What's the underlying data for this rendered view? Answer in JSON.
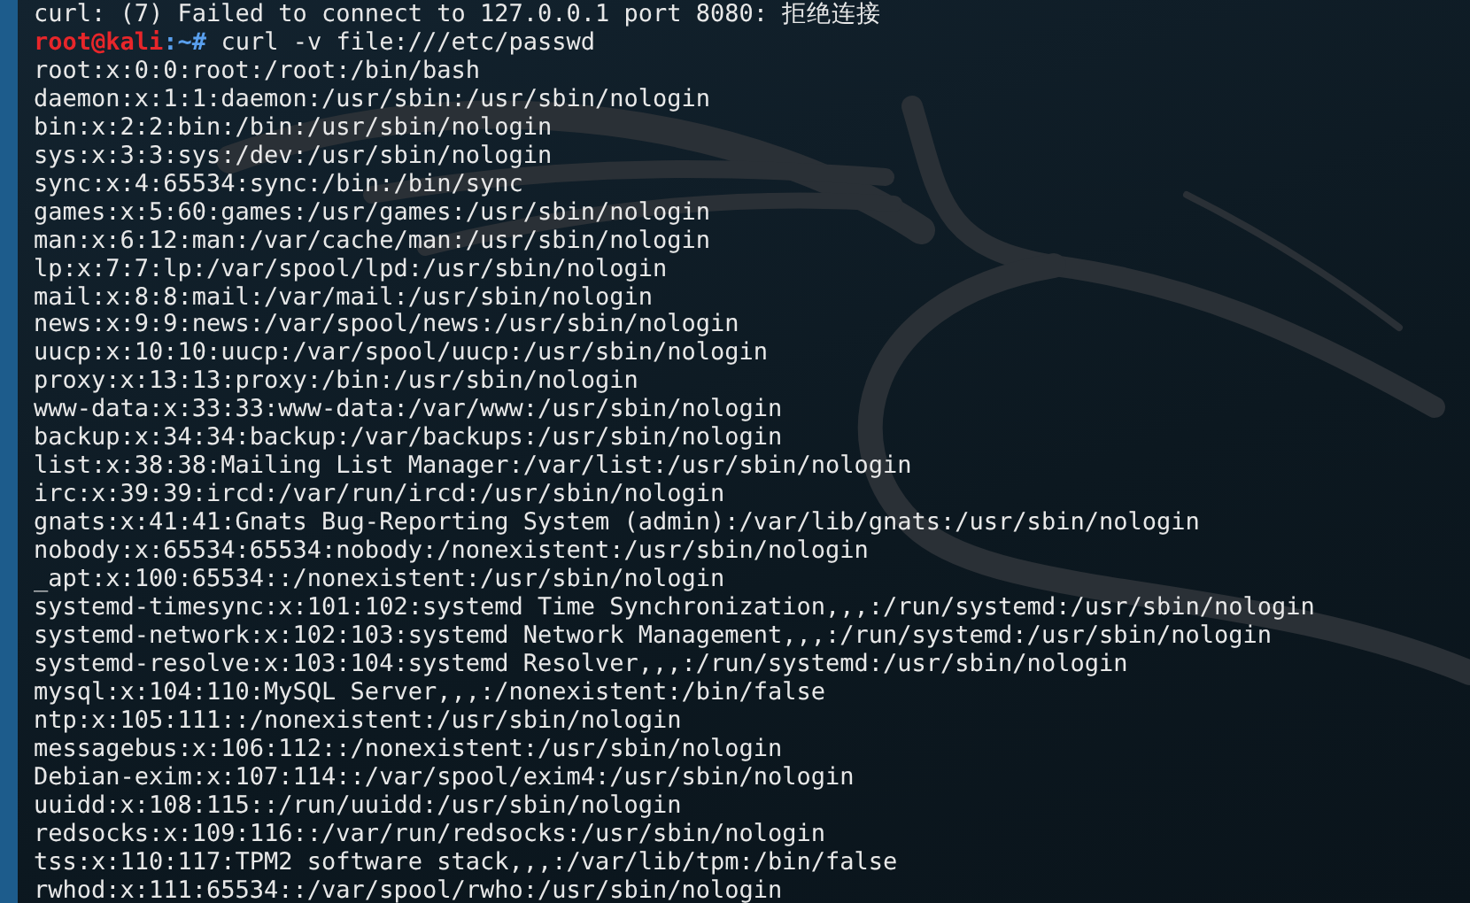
{
  "terminal": {
    "lines_before": [
      "curl: (7) Failed to connect to 127.0.0.1 port 8080: 拒绝连接"
    ],
    "prompt": {
      "user_host": "root@kali",
      "path": ":~#",
      "command": "curl -v file:///etc/passwd"
    },
    "output": [
      "root:x:0:0:root:/root:/bin/bash",
      "daemon:x:1:1:daemon:/usr/sbin:/usr/sbin/nologin",
      "bin:x:2:2:bin:/bin:/usr/sbin/nologin",
      "sys:x:3:3:sys:/dev:/usr/sbin/nologin",
      "sync:x:4:65534:sync:/bin:/bin/sync",
      "games:x:5:60:games:/usr/games:/usr/sbin/nologin",
      "man:x:6:12:man:/var/cache/man:/usr/sbin/nologin",
      "lp:x:7:7:lp:/var/spool/lpd:/usr/sbin/nologin",
      "mail:x:8:8:mail:/var/mail:/usr/sbin/nologin",
      "news:x:9:9:news:/var/spool/news:/usr/sbin/nologin",
      "uucp:x:10:10:uucp:/var/spool/uucp:/usr/sbin/nologin",
      "proxy:x:13:13:proxy:/bin:/usr/sbin/nologin",
      "www-data:x:33:33:www-data:/var/www:/usr/sbin/nologin",
      "backup:x:34:34:backup:/var/backups:/usr/sbin/nologin",
      "list:x:38:38:Mailing List Manager:/var/list:/usr/sbin/nologin",
      "irc:x:39:39:ircd:/var/run/ircd:/usr/sbin/nologin",
      "gnats:x:41:41:Gnats Bug-Reporting System (admin):/var/lib/gnats:/usr/sbin/nologin",
      "nobody:x:65534:65534:nobody:/nonexistent:/usr/sbin/nologin",
      "_apt:x:100:65534::/nonexistent:/usr/sbin/nologin",
      "systemd-timesync:x:101:102:systemd Time Synchronization,,,:/run/systemd:/usr/sbin/nologin",
      "systemd-network:x:102:103:systemd Network Management,,,:/run/systemd:/usr/sbin/nologin",
      "systemd-resolve:x:103:104:systemd Resolver,,,:/run/systemd:/usr/sbin/nologin",
      "mysql:x:104:110:MySQL Server,,,:/nonexistent:/bin/false",
      "ntp:x:105:111::/nonexistent:/usr/sbin/nologin",
      "messagebus:x:106:112::/nonexistent:/usr/sbin/nologin",
      "Debian-exim:x:107:114::/var/spool/exim4:/usr/sbin/nologin",
      "uuidd:x:108:115::/run/uuidd:/usr/sbin/nologin",
      "redsocks:x:109:116::/var/run/redsocks:/usr/sbin/nologin",
      "tss:x:110:117:TPM2 software stack,,,:/var/lib/tpm:/bin/false",
      "rwhod:x:111:65534::/var/spool/rwho:/usr/sbin/nologin"
    ]
  }
}
